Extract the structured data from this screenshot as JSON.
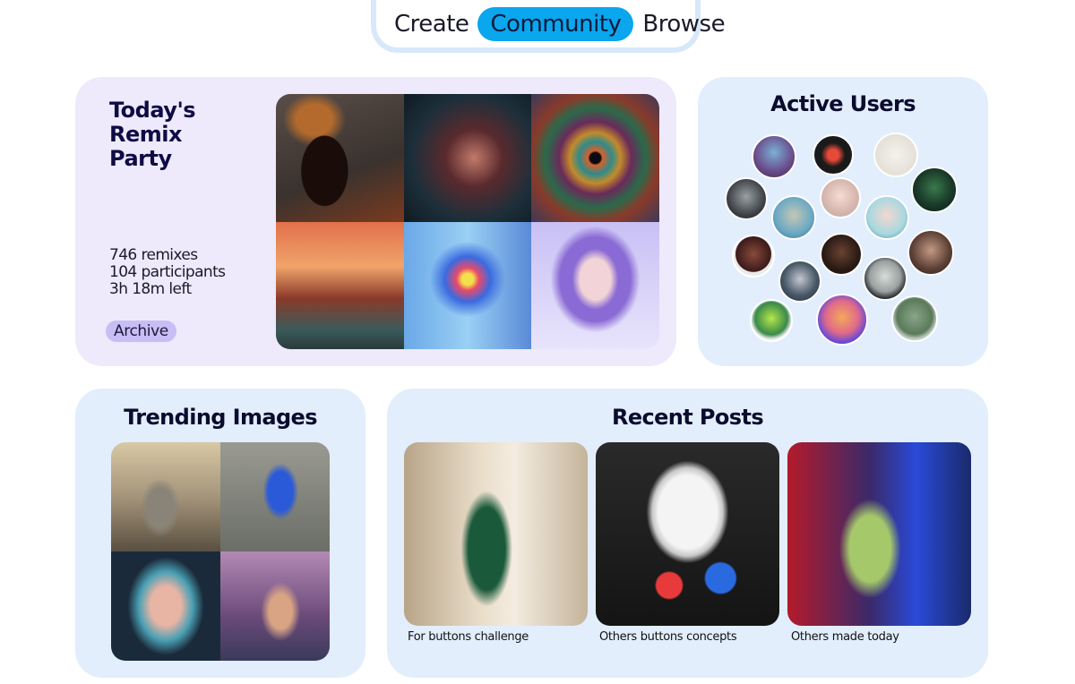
{
  "nav": {
    "tabs": [
      {
        "label": "Create"
      },
      {
        "label": "Community"
      },
      {
        "label": "Browse"
      }
    ],
    "active": "Community"
  },
  "remix_party": {
    "title": "Today's Remix Party",
    "remixes": "746 remixes",
    "participants": "104 participants",
    "time_left": "3h 18m left",
    "archive_label": "Archive"
  },
  "active_users": {
    "title": "Active Users",
    "count": 17
  },
  "trending": {
    "title": "Trending Images"
  },
  "recent_posts": {
    "title": "Recent Posts",
    "posts": [
      {
        "caption": "For buttons challenge"
      },
      {
        "caption": "Others buttons concepts"
      },
      {
        "caption": "Others made today"
      }
    ]
  },
  "colors": {
    "accent": "#0aa6ee",
    "remix_bg": "#eeeafc",
    "card_bg": "#e2eefc",
    "archive_bg": "#c9bdf5"
  }
}
